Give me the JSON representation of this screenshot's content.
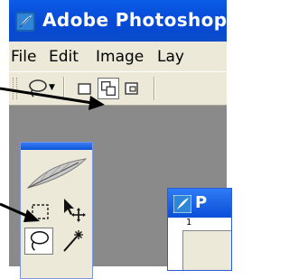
{
  "window": {
    "title": "Adobe Photoshop",
    "icon": "photoshop-feather-icon",
    "title_bar_color": "#0a52dc"
  },
  "menubar": {
    "items": [
      {
        "label": "File"
      },
      {
        "label": "Edit"
      },
      {
        "label": "Image"
      },
      {
        "label": "Lay"
      }
    ]
  },
  "options_bar": {
    "tool_preset_icon": "lasso-icon",
    "selection_modes": [
      {
        "icon": "new-selection-icon",
        "active": false
      },
      {
        "icon": "add-to-selection-icon",
        "active": true
      },
      {
        "icon": "subtract-from-selection-icon",
        "active": false
      }
    ]
  },
  "toolbox": {
    "header_icon": "feather-icon",
    "tools": [
      {
        "icon": "rectangular-marquee-icon",
        "selected": false
      },
      {
        "icon": "move-tool-icon",
        "selected": false
      },
      {
        "icon": "lasso-icon",
        "selected": true
      },
      {
        "icon": "magic-wand-icon",
        "selected": false
      }
    ]
  },
  "document": {
    "title_partial": "P",
    "ruler_label": "1"
  },
  "annotations": {
    "arrow_color": "#000000"
  }
}
